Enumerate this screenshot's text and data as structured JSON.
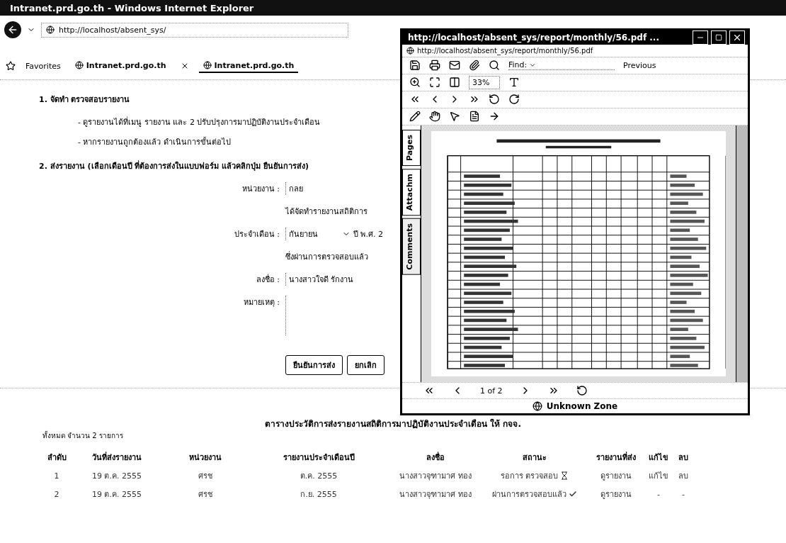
{
  "browser": {
    "title": "Intranet.prd.go.th - Windows Internet Explorer",
    "address": "http://localhost/absent_sys/",
    "favorites": "Favorites",
    "tabs": [
      {
        "label": "Intranet.prd.go.th",
        "selected": false
      },
      {
        "label": "Intranet.prd.go.th",
        "selected": true
      }
    ]
  },
  "step1": {
    "heading": "1. จัดทำ ตรวจสอบรายงาน",
    "bullets": [
      "- ดูรายงานได้ที่เมนู รายงาน และ 2 ปรับปรุงการมาปฏิบัติงานประจำเดือน",
      "- หากรายงานถูกต้องแล้ว ดำเนินการขั้นต่อไป"
    ]
  },
  "step2": {
    "heading": "2. ส่งรายงาน (เลือกเดือนปี ที่ต้องการส่งในแบบฟอร์ม แล้วคลิกปุ่ม ยืนยันการส่ง)"
  },
  "form": {
    "unit_label": "หน่วยงาน :",
    "unit_value": "กลย",
    "statement": "ได้จัดทำรายงานสถิติการ",
    "month_label": "ประจำเดือน :",
    "month_value": "กันยายน",
    "year_value": "ปี พ.ศ. 2",
    "confirm_text": "ซึ่งผ่านการตรวจสอบแล้ว",
    "signer_label": "ลงชื่อ :",
    "signer_value": "นางสาวใจดี รักงาน",
    "note_label": "หมายเหตุ :",
    "buttons": [
      "ยืนยันการส่ง",
      "ยกเลิก"
    ]
  },
  "history": {
    "title": "ตารางประวัติการส่งรายงานสถิติการมาปฏิบัติงานประจำเดือน ให้ กจจ.",
    "count": "ทั้งหมด จำนวน 2 รายการ",
    "columns": [
      "ลำดับ",
      "วันที่ส่งรายงาน",
      "หน่วยงาน",
      "รายงานประจำเดือนปี",
      "ลงชื่อ",
      "สถานะ",
      "รายงานที่ส่ง",
      "แก้ไข",
      "ลบ"
    ],
    "rows": [
      {
        "no": "1",
        "date": "19 ต.ค. 2555",
        "unit": "ศรช",
        "period": "ต.ค. 2555",
        "signer": "นางสาวจุฑามาศ ทอง",
        "status": "รอการ ตรวจสอบ",
        "verified": false,
        "report": "ดูรายงาน",
        "edit": "แก้ไข",
        "delete": "ลบ"
      },
      {
        "no": "2",
        "date": "19 ต.ค. 2555",
        "unit": "ศรช",
        "period": "ก.ย. 2555",
        "signer": "นางสาวจุฑามาศ ทอง",
        "status": "ผ่านการตรวจสอบแล้ว",
        "verified": true,
        "report": "ดูรายงาน",
        "edit": "-",
        "delete": "-"
      }
    ]
  },
  "pdf_window": {
    "title": "http://localhost/absent_sys/report/monthly/56.pdf ...",
    "address": "http://localhost/absent_sys/report/monthly/56.pdf",
    "find_label": "Find:",
    "previous": "Previous",
    "zoom": "33%",
    "side_tabs": [
      {
        "label": "Pages",
        "selected": false
      },
      {
        "label": "Attachm",
        "selected": false
      },
      {
        "label": "Comments",
        "selected": true
      }
    ],
    "page_indicator": "1 of 2",
    "zone": "Unknown Zone"
  }
}
